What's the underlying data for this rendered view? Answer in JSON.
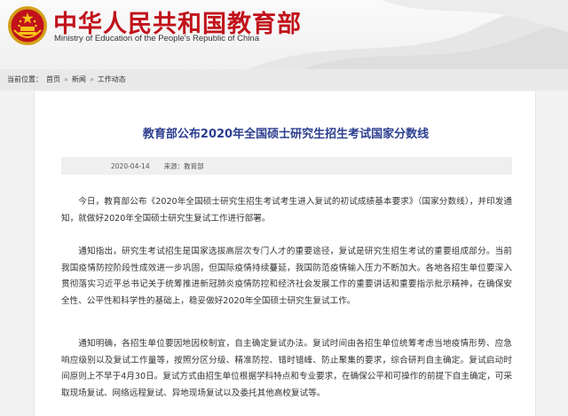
{
  "header": {
    "title": "中华人民共和国教育部",
    "subtitle": "Ministry of Education of the People's Republic of China",
    "brand_color": "#c1121b"
  },
  "breadcrumb": {
    "prefix": "当前位置：",
    "items": [
      "首页",
      "新闻",
      "工作动态"
    ]
  },
  "article": {
    "title": "教育部公布2020年全国硕士研究生招生考试国家分数线",
    "date": "2020-04-14",
    "source": "来源：教育部",
    "paragraphs": [
      "今日，教育部公布《2020年全国硕士研究生招生考试考生进入复试的初试成绩基本要求》（国家分数线），并印发通知，就做好2020年全国硕士研究生复试工作进行部署。",
      "通知指出，研究生考试招生是国家选拔高层次专门人才的重要途径，复试是研究生招生考试的重要组成部分。当前我国疫情防控阶段性成效进一步巩固，但国际疫情持续蔓延，我国防范疫情输入压力不断加大。各地各招生单位要深入贯彻落实习近平总书记关于统筹推进新冠肺炎疫情防控和经济社会发展工作的重要讲话和重要指示批示精神，在确保安全性、公平性和科学性的基础上，稳妥做好2020年全国硕士研究生复试工作。",
      "通知明确，各招生单位要因地因校制宜，自主确定复试办法。复试时间由各招生单位统筹考虑当地疫情形势、应急响应级别以及复试工作量等，按照分区分级、精准防控、错时错峰、防止聚集的要求，综合研判自主确定。复试启动时间原则上不早于4月30日。复试方式由招生单位根据学科特点和专业要求，在确保公平和可操作的前提下自主确定，可采取现场复试、网络远程复试、异地现场复试以及委托其他高校复试等。"
    ],
    "title_color": "#2c3e8f"
  },
  "icons": {
    "emblem": "national-emblem-icon",
    "breadcrumb_sep": "double-chevron-right-icon"
  }
}
